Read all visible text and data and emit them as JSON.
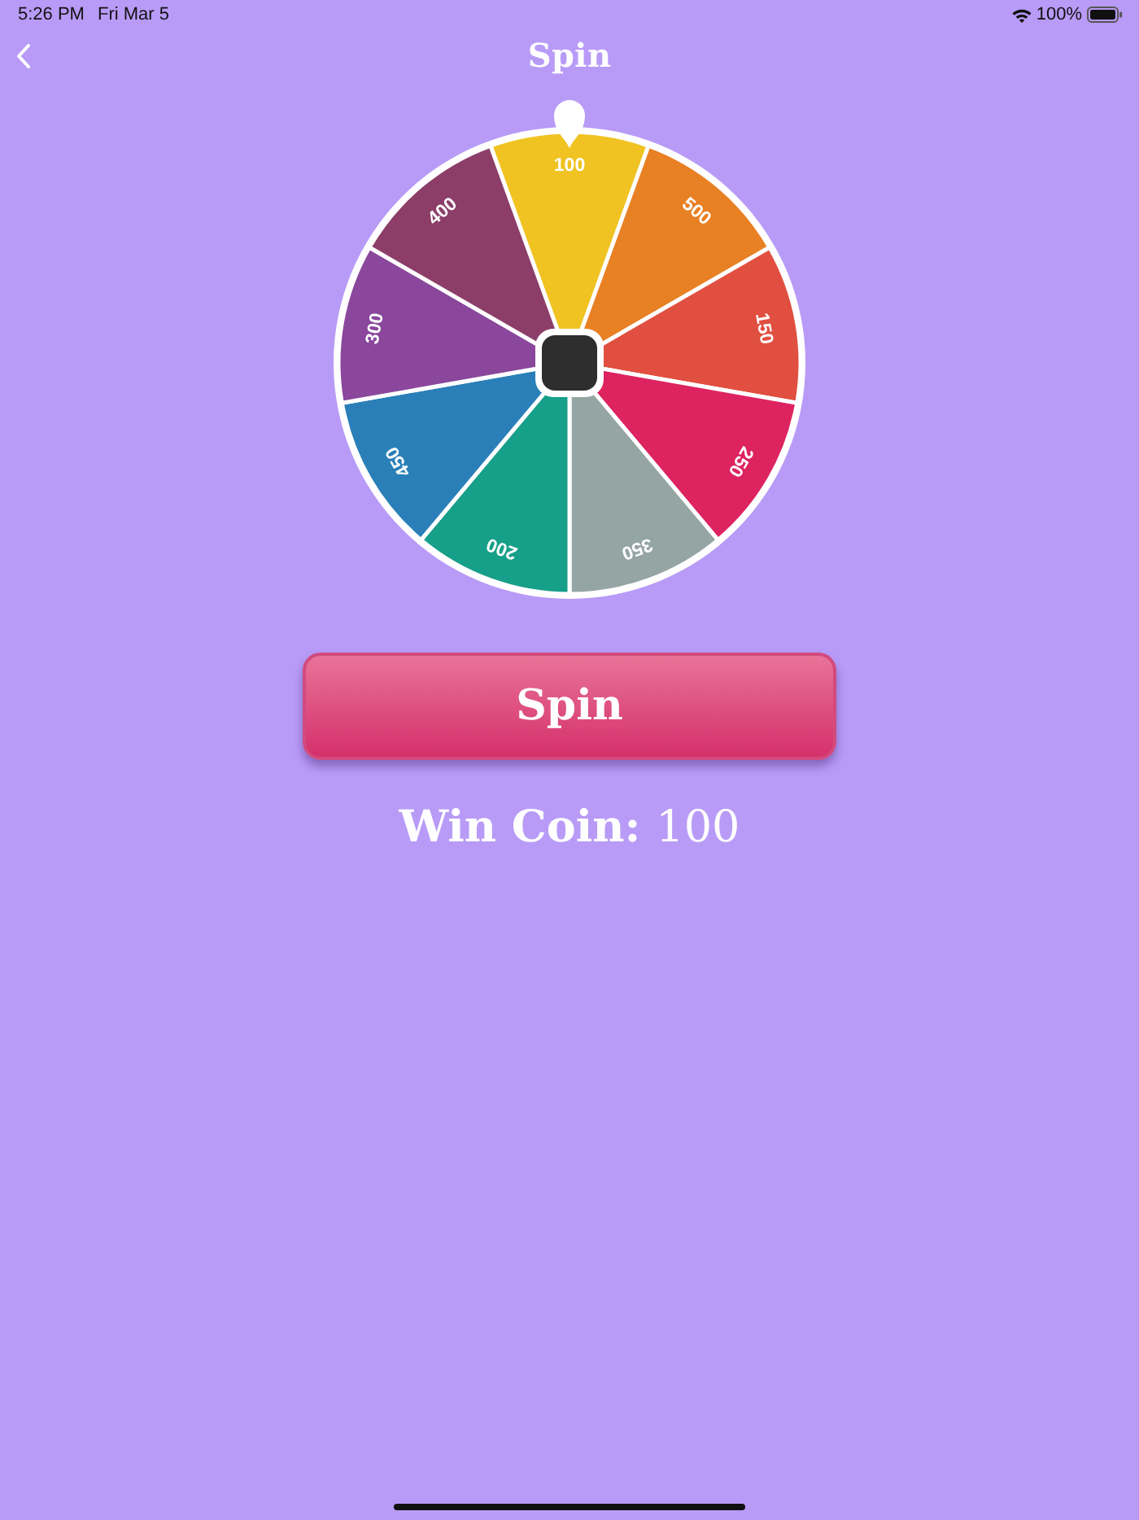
{
  "status_bar": {
    "time": "5:26 PM",
    "date": "Fri Mar 5",
    "battery": "100%"
  },
  "nav_bar": {
    "title": "Spin"
  },
  "wheel": {
    "segments": [
      {
        "label": "100",
        "color": "#f0c322"
      },
      {
        "label": "500",
        "color": "#e88024"
      },
      {
        "label": "150",
        "color": "#e04f3f"
      },
      {
        "label": "250",
        "color": "#dd2360"
      },
      {
        "label": "350",
        "color": "#95a5a4"
      },
      {
        "label": "200",
        "color": "#169f89"
      },
      {
        "label": "450",
        "color": "#2a7fb8"
      },
      {
        "label": "300",
        "color": "#8a479c"
      },
      {
        "label": "400",
        "color": "#8c3e69"
      }
    ]
  },
  "spin_button": {
    "label": "Spin"
  },
  "result": {
    "label": "Win Coin:",
    "value": "100"
  }
}
